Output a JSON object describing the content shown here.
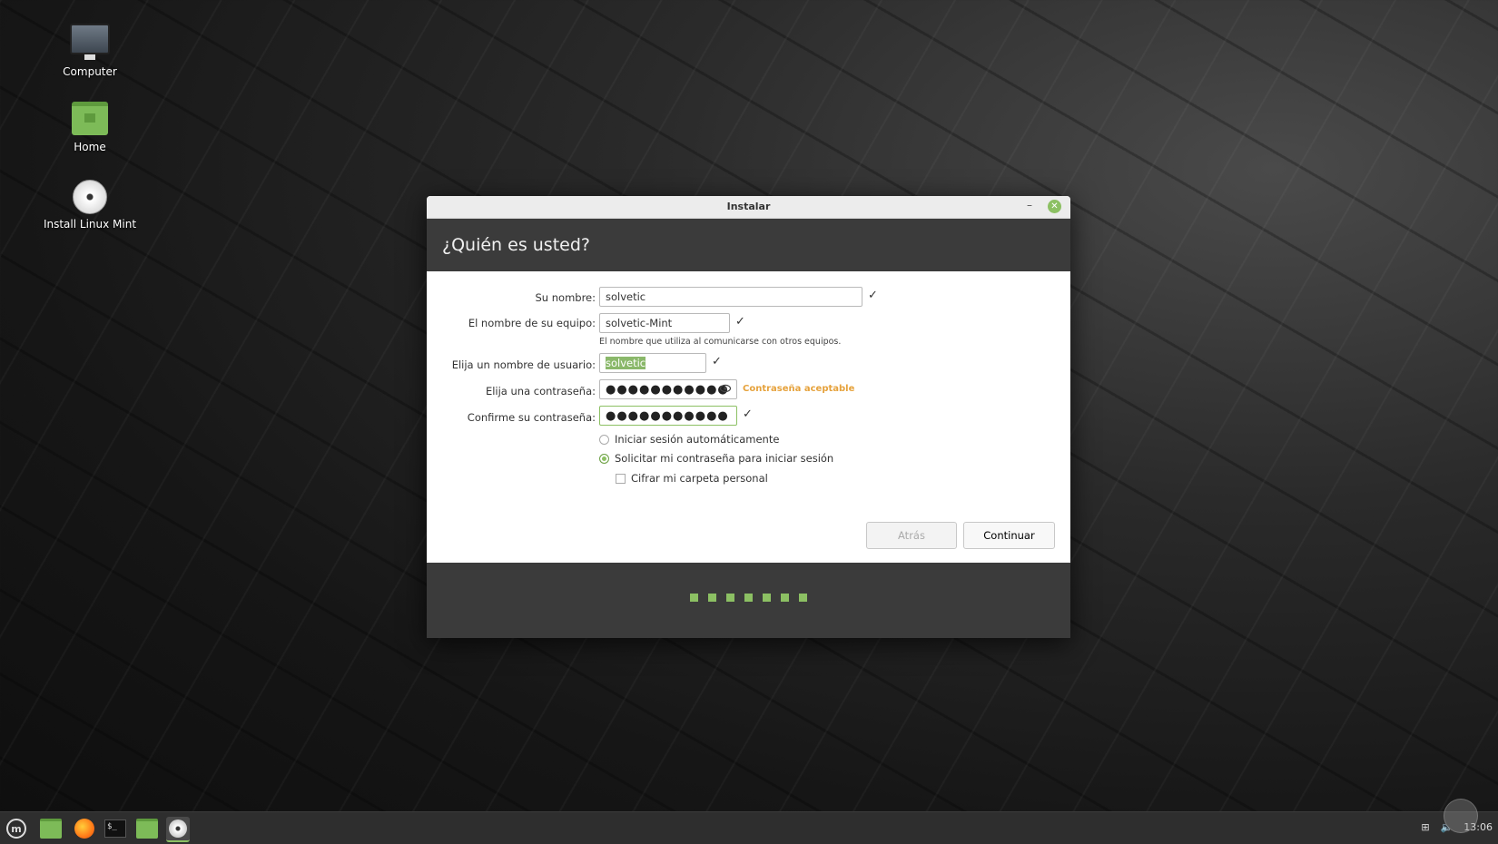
{
  "desktop": {
    "icons": [
      {
        "label": "Computer"
      },
      {
        "label": "Home"
      },
      {
        "label": "Install Linux Mint"
      }
    ]
  },
  "window": {
    "title": "Instalar",
    "header": "¿Quién es usted?",
    "fields": {
      "name_label": "Su nombre:",
      "name_value": "solvetic",
      "computer_label": "El nombre de su equipo:",
      "computer_value": "solvetic-Mint",
      "computer_hint": "El nombre que utiliza al comunicarse con otros equipos.",
      "username_label": "Elija un nombre de usuario:",
      "username_value": "solvetic",
      "password_label": "Elija una contraseña:",
      "password_value": "●●●●●●●●●●●",
      "password_strength": "Contraseña aceptable",
      "confirm_label": "Confirme su contraseña:",
      "confirm_value": "●●●●●●●●●●●"
    },
    "options": {
      "autologin": "Iniciar sesión automáticamente",
      "require_password": "Solicitar mi contraseña para iniciar sesión",
      "encrypt_home": "Cifrar mi carpeta personal"
    },
    "buttons": {
      "back": "Atrás",
      "continue": "Continuar"
    },
    "progress": {
      "steps_total": 7,
      "accent": "#8cc063"
    }
  },
  "taskbar": {
    "clock": "13:06"
  }
}
